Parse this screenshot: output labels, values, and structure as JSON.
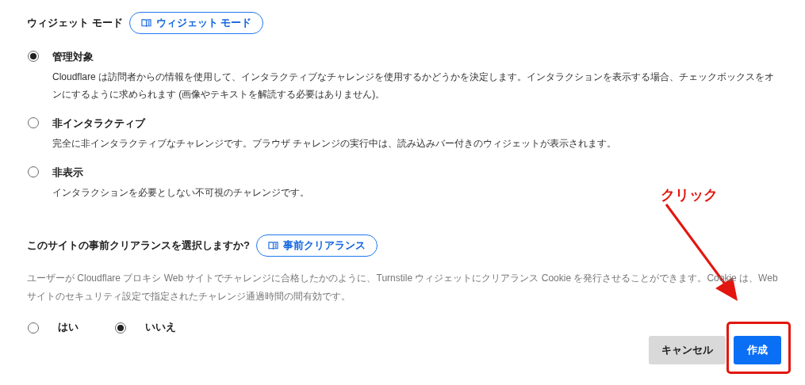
{
  "widget_mode": {
    "label": "ウィジェット モード",
    "doc_link": "ウィジェット モード",
    "options": [
      {
        "label": "管理対象",
        "description": "Cloudflare は訪問者からの情報を使用して、インタラクティブなチャレンジを使用するかどうかを決定します。インタラクションを表示する場合、チェックボックスをオンにするように求められます (画像やテキストを解読する必要はありません)。",
        "selected": true
      },
      {
        "label": "非インタラクティブ",
        "description": "完全に非インタラクティブなチャレンジです。ブラウザ チャレンジの実行中は、読み込みバー付きのウィジェットが表示されます。",
        "selected": false
      },
      {
        "label": "非表示",
        "description": "インタラクションを必要としない不可視のチャレンジです。",
        "selected": false
      }
    ]
  },
  "preclearance": {
    "label": "このサイトの事前クリアランスを選択しますか?",
    "doc_link": "事前クリアランス",
    "description": "ユーザーが Cloudflare プロキシ Web サイトでチャレンジに合格したかのように、Turnstile ウィジェットにクリアランス Cookie を発行させることができます。Cookie は、Web サイトのセキュリティ設定で指定されたチャレンジ通過時間の間有効です。",
    "options": [
      {
        "label": "はい",
        "selected": false
      },
      {
        "label": "いいえ",
        "selected": true
      }
    ]
  },
  "buttons": [
    {
      "label": "キャンセル",
      "kind": "secondary"
    },
    {
      "label": "作成",
      "kind": "primary",
      "highlighted": true
    }
  ],
  "annotation": {
    "label": "クリック"
  }
}
